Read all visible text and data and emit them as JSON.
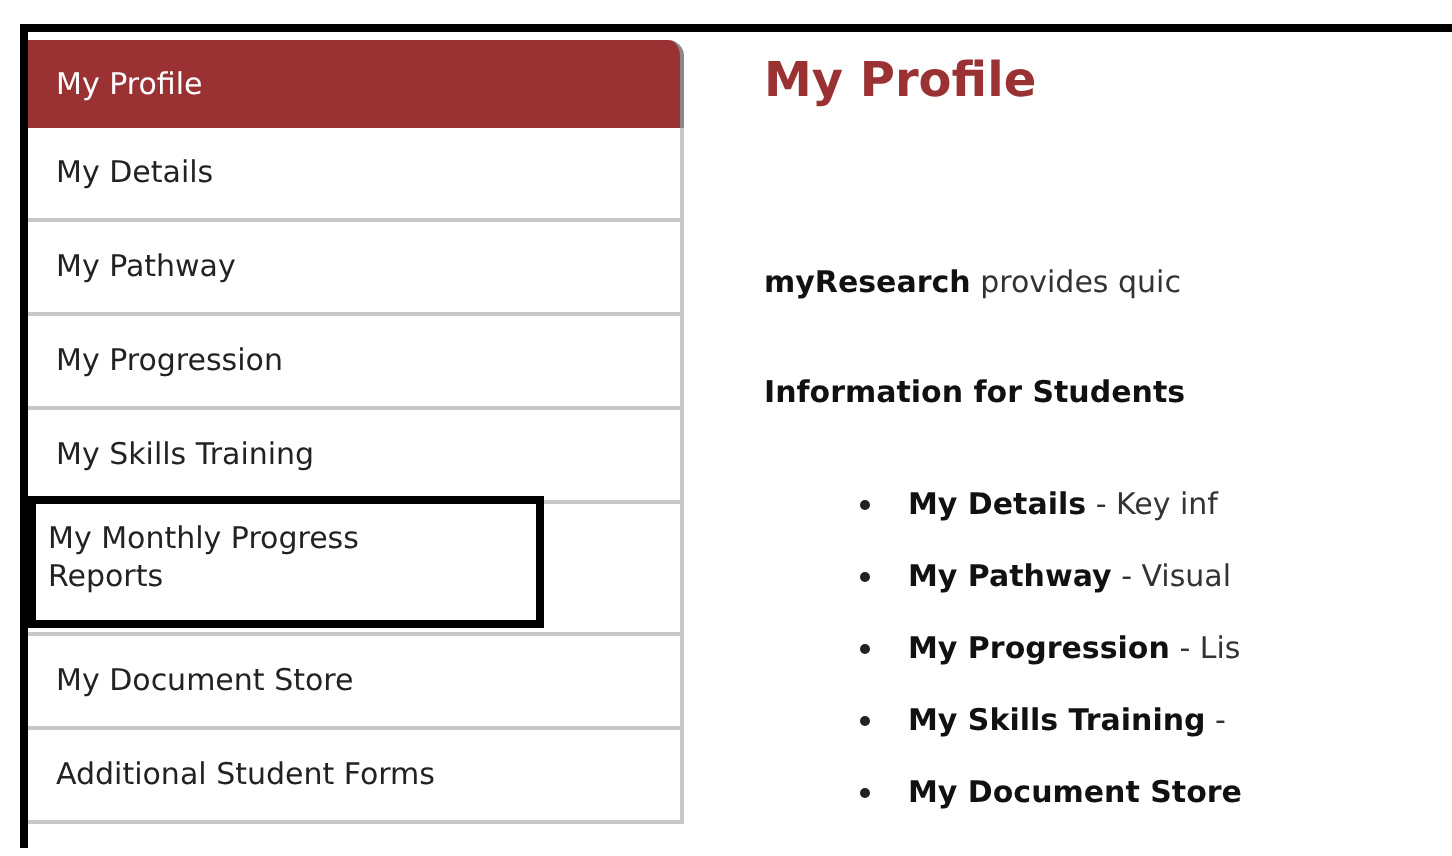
{
  "sidebar": {
    "header": {
      "label": "My Profile",
      "selected": true
    },
    "items": [
      {
        "label": "My Details",
        "selected": false,
        "highlighted": false
      },
      {
        "label": "My Pathway",
        "selected": false,
        "highlighted": false
      },
      {
        "label": "My Progression",
        "selected": false,
        "highlighted": false
      },
      {
        "label": "My Skills Training",
        "selected": false,
        "highlighted": false
      },
      {
        "label": "My Monthly Progress Reports",
        "selected": false,
        "highlighted": true
      },
      {
        "label": "My Document Store",
        "selected": false,
        "highlighted": false
      },
      {
        "label": "Additional Student Forms",
        "selected": false,
        "highlighted": false
      }
    ]
  },
  "content": {
    "title": "My Profile",
    "intro": "**myResearch** provides quic",
    "subheading": "Information for Students",
    "links": [
      {
        "name": "My Details",
        "text": " - Key inf"
      },
      {
        "name": "My Pathway",
        "text": " - Visual"
      },
      {
        "name": "My Progression",
        "text": " - Lis"
      },
      {
        "name": "My Skills Training",
        "text": " -"
      },
      {
        "name": "My Document Store"
      }
    ]
  }
}
